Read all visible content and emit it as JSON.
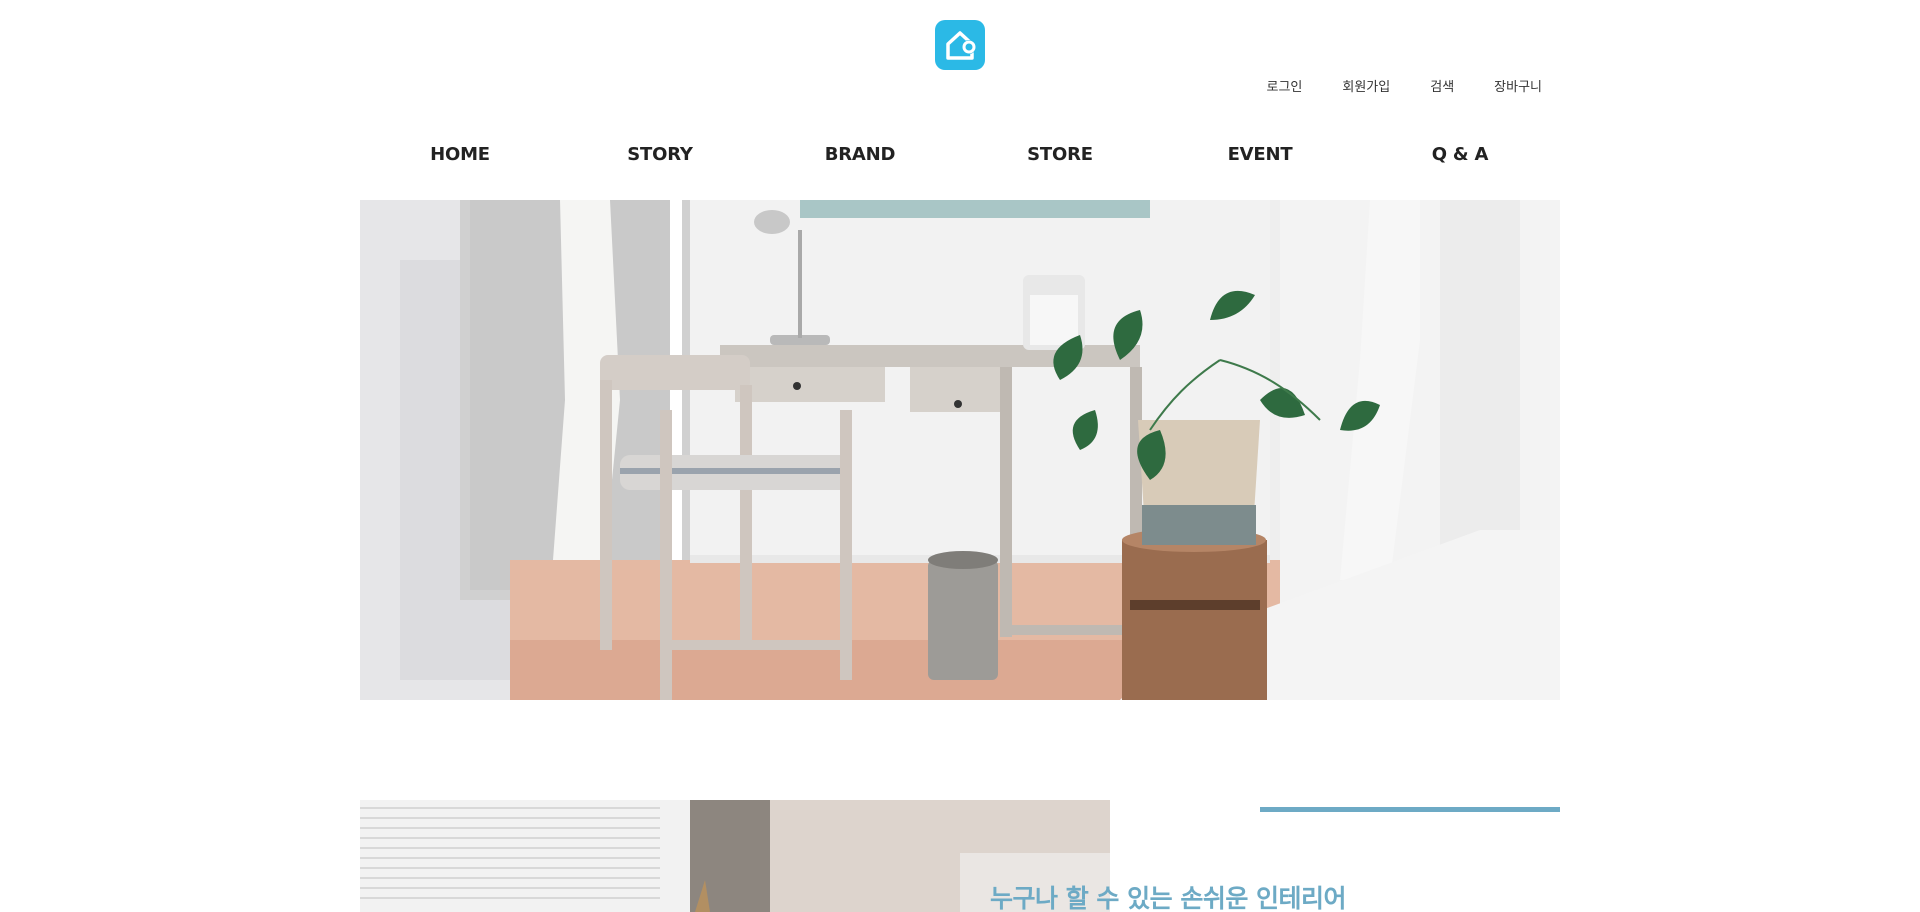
{
  "header": {
    "logo_icon": "home-location-icon",
    "brand_color": "#2bb9e6",
    "util_links": [
      {
        "label": "로그인"
      },
      {
        "label": "회원가입"
      },
      {
        "label": "검색"
      },
      {
        "label": "장바구니"
      }
    ]
  },
  "gnb": {
    "items": [
      {
        "label": "HOME"
      },
      {
        "label": "STORY"
      },
      {
        "label": "BRAND"
      },
      {
        "label": "STORE"
      },
      {
        "label": "EVENT"
      },
      {
        "label": "Q & A"
      }
    ]
  },
  "hero": {
    "image": "room-desk-chair-plant-photo"
  },
  "section": {
    "image": "window-blinds-lamp-photo",
    "accent_color": "#6daac5",
    "title": "누구나 할 수 있는 손쉬운 인테리어"
  }
}
